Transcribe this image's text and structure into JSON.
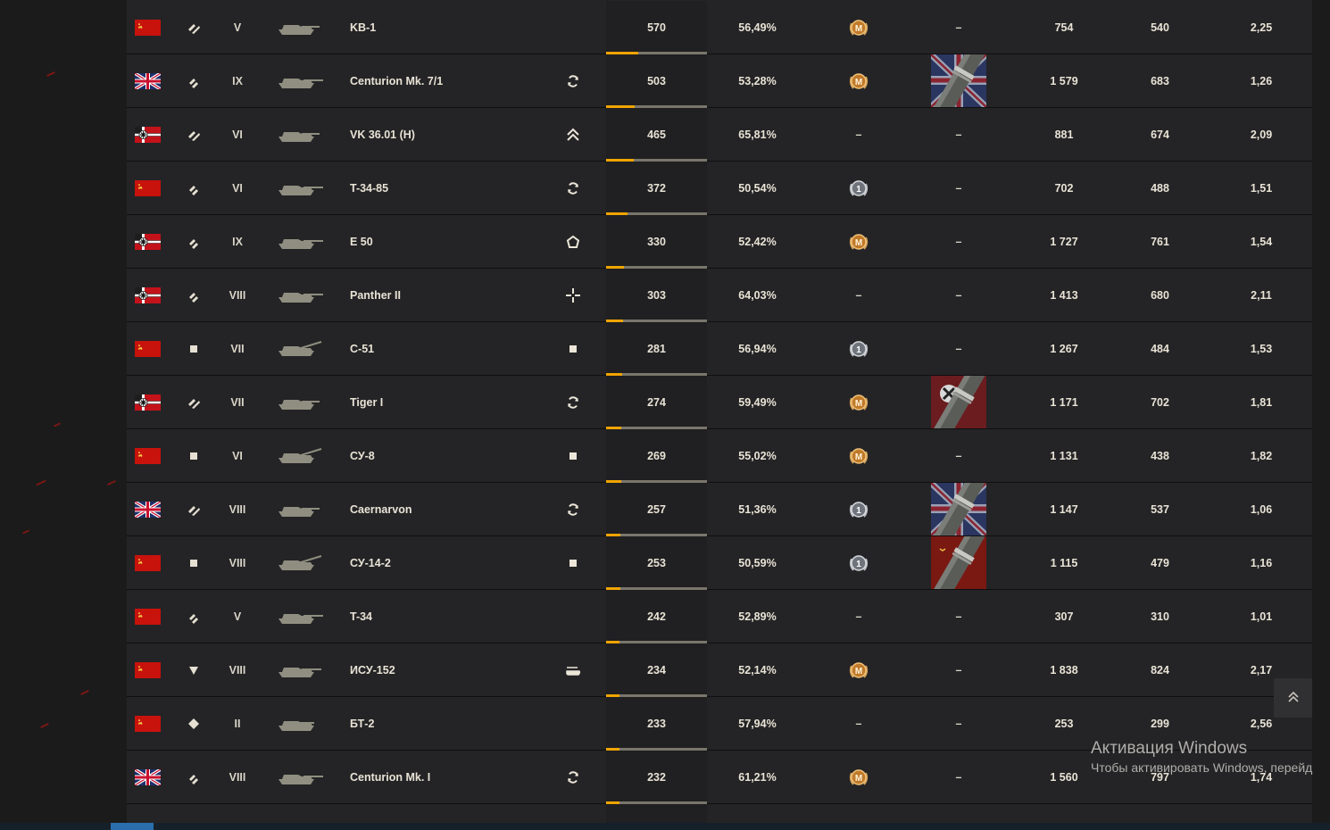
{
  "rows": [
    {
      "flag": "ussr",
      "class": "heavy",
      "tier": "V",
      "tank": "KB-1",
      "role": "",
      "battles": "570",
      "wr": "56,49%",
      "mastery": "M",
      "marks": "",
      "dmg": "754",
      "exp": "540",
      "kd": "2,25",
      "progress": 0.32
    },
    {
      "flag": "uk",
      "class": "medium",
      "tier": "IX",
      "tank": "Centurion Mk. 7/1",
      "role": "cycle",
      "battles": "503",
      "wr": "53,28%",
      "mastery": "M",
      "marks": "uk",
      "dmg": "1 579",
      "exp": "683",
      "kd": "1,26",
      "progress": 0.28
    },
    {
      "flag": "ger",
      "class": "heavy",
      "tier": "VI",
      "tank": "VK 36.01 (H)",
      "role": "chevrons",
      "battles": "465",
      "wr": "65,81%",
      "mastery": "",
      "marks": "",
      "dmg": "881",
      "exp": "674",
      "kd": "2,09",
      "progress": 0.27
    },
    {
      "flag": "ussr",
      "class": "medium",
      "tier": "VI",
      "tank": "T-34-85",
      "role": "cycle",
      "battles": "372",
      "wr": "50,54%",
      "mastery": "1",
      "marks": "",
      "dmg": "702",
      "exp": "488",
      "kd": "1,51",
      "progress": 0.21
    },
    {
      "flag": "ger",
      "class": "medium",
      "tier": "IX",
      "tank": "E 50",
      "role": "pentagon",
      "battles": "330",
      "wr": "52,42%",
      "mastery": "M",
      "marks": "",
      "dmg": "1 727",
      "exp": "761",
      "kd": "1,54",
      "progress": 0.18
    },
    {
      "flag": "ger",
      "class": "medium",
      "tier": "VIII",
      "tank": "Panther II",
      "role": "crosshair",
      "battles": "303",
      "wr": "64,03%",
      "mastery": "",
      "marks": "",
      "dmg": "1 413",
      "exp": "680",
      "kd": "2,11",
      "progress": 0.17
    },
    {
      "flag": "ussr",
      "class": "spg",
      "tier": "VII",
      "tank": "С-51",
      "role": "square",
      "battles": "281",
      "wr": "56,94%",
      "mastery": "1",
      "marks": "",
      "dmg": "1 267",
      "exp": "484",
      "kd": "1,53",
      "progress": 0.16
    },
    {
      "flag": "ger",
      "class": "heavy",
      "tier": "VII",
      "tank": "Tiger I",
      "role": "cycle",
      "battles": "274",
      "wr": "59,49%",
      "mastery": "M",
      "marks": "ger",
      "dmg": "1 171",
      "exp": "702",
      "kd": "1,81",
      "progress": 0.15
    },
    {
      "flag": "ussr",
      "class": "spg",
      "tier": "VI",
      "tank": "СУ-8",
      "role": "square",
      "battles": "269",
      "wr": "55,02%",
      "mastery": "M",
      "marks": "",
      "dmg": "1 131",
      "exp": "438",
      "kd": "1,82",
      "progress": 0.15
    },
    {
      "flag": "uk",
      "class": "heavy",
      "tier": "VIII",
      "tank": "Caernarvon",
      "role": "cycle",
      "battles": "257",
      "wr": "51,36%",
      "mastery": "1",
      "marks": "uk",
      "dmg": "1 147",
      "exp": "537",
      "kd": "1,06",
      "progress": 0.14
    },
    {
      "flag": "ussr",
      "class": "spg",
      "tier": "VIII",
      "tank": "СУ-14-2",
      "role": "square",
      "battles": "253",
      "wr": "50,59%",
      "mastery": "1",
      "marks": "ussr",
      "dmg": "1 115",
      "exp": "479",
      "kd": "1,16",
      "progress": 0.14
    },
    {
      "flag": "ussr",
      "class": "medium",
      "tier": "V",
      "tank": "T-34",
      "role": "",
      "battles": "242",
      "wr": "52,89%",
      "mastery": "",
      "marks": "",
      "dmg": "307",
      "exp": "310",
      "kd": "1,01",
      "progress": 0.13
    },
    {
      "flag": "ussr",
      "class": "td",
      "tier": "VIII",
      "tank": "ИСУ-152",
      "role": "td-role",
      "battles": "234",
      "wr": "52,14%",
      "mastery": "M",
      "marks": "",
      "dmg": "1 838",
      "exp": "824",
      "kd": "2,17",
      "progress": 0.13
    },
    {
      "flag": "ussr",
      "class": "light",
      "tier": "II",
      "tank": "БТ-2",
      "role": "",
      "battles": "233",
      "wr": "57,94%",
      "mastery": "",
      "marks": "",
      "dmg": "253",
      "exp": "299",
      "kd": "2,56",
      "progress": 0.13
    },
    {
      "flag": "uk",
      "class": "medium",
      "tier": "VIII",
      "tank": "Centurion Mk. I",
      "role": "cycle",
      "battles": "232",
      "wr": "61,21%",
      "mastery": "M",
      "marks": "",
      "dmg": "1 560",
      "exp": "797",
      "kd": "1,74",
      "progress": 0.13
    }
  ],
  "empty_value": "–",
  "scroll_top_icon": "double-chevron-up-icon",
  "activation": {
    "title": "Активация Windows",
    "subtitle": "Чтобы активировать Windows, перейд"
  },
  "colors": {
    "accent": "#f0a400",
    "background": "#1b1b1c",
    "row_bg": "#242426",
    "text": "#e9e3d6",
    "ember": "#9b1710"
  }
}
